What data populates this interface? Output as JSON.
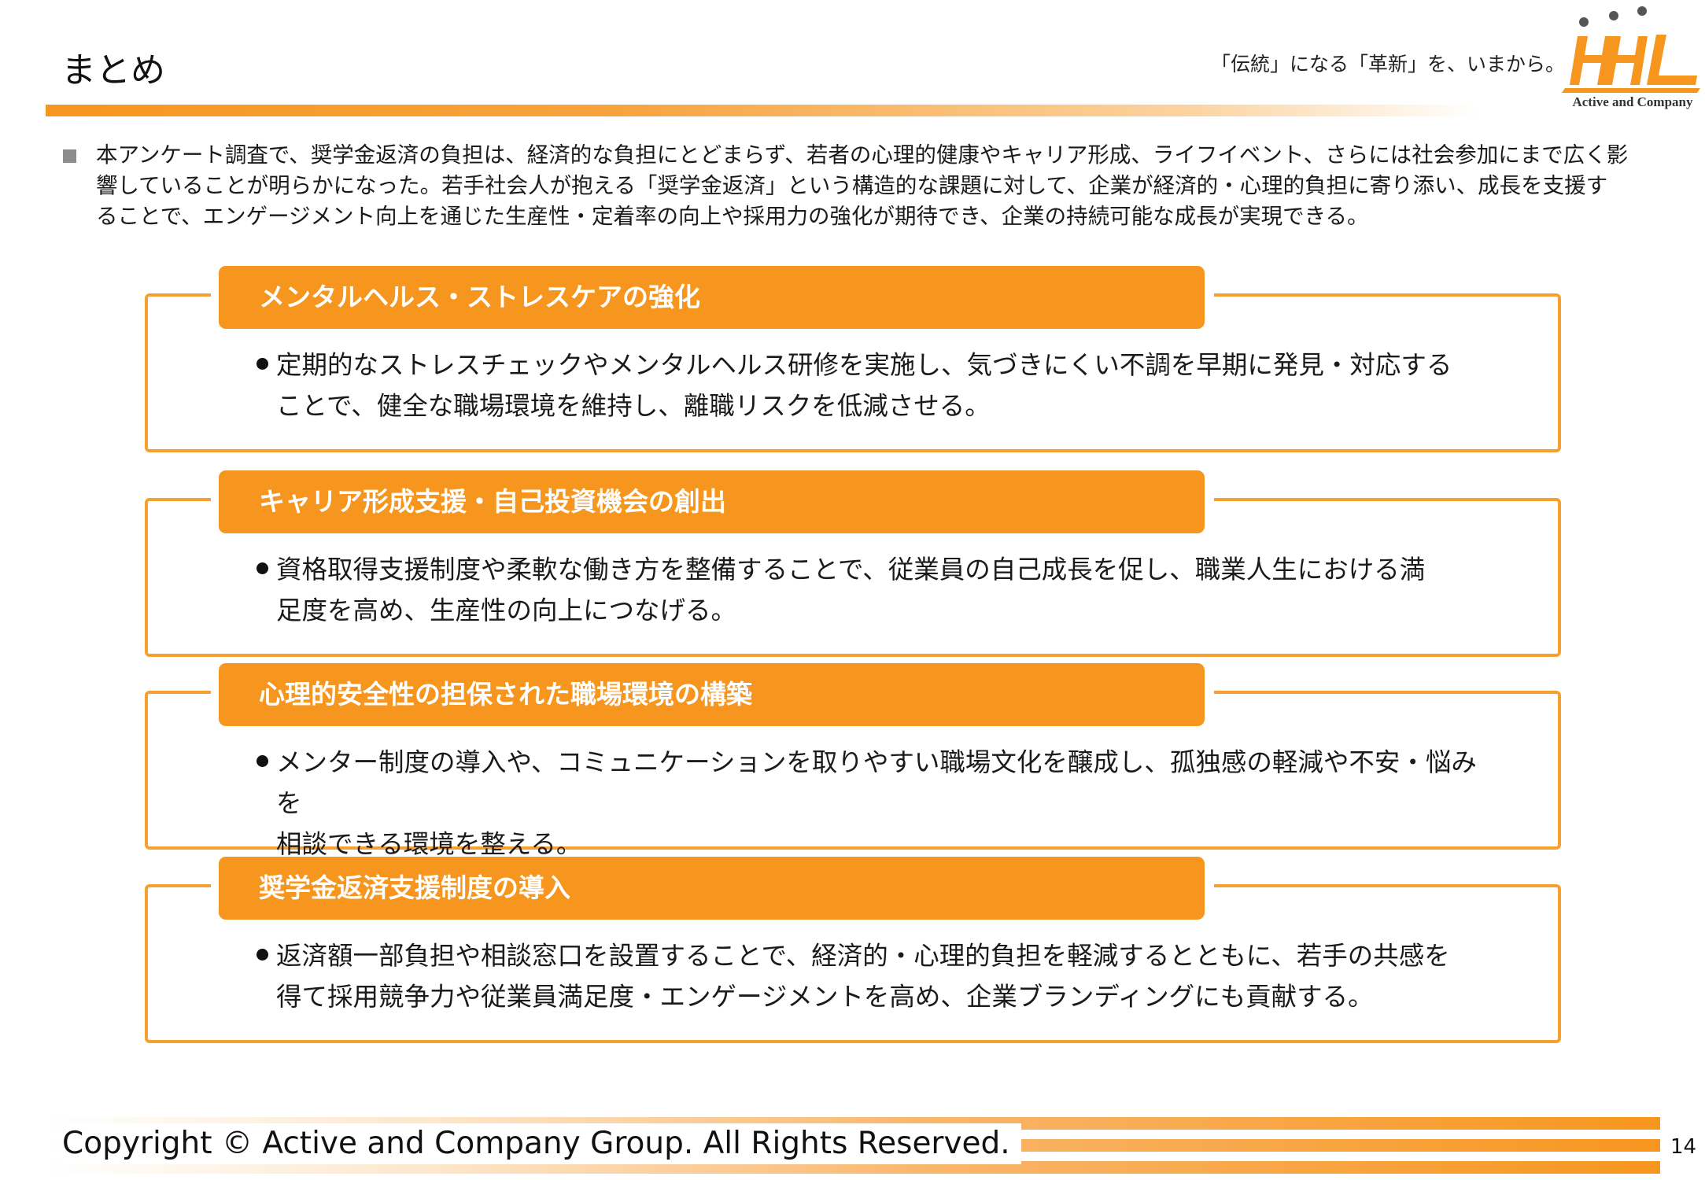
{
  "header": {
    "title": "まとめ",
    "tagline": "「伝統」になる「革新」を、いまから。",
    "logo_caption": "Active and Company"
  },
  "summary": {
    "text": "本アンケート調査で、奨学金返済の負担は、経済的な負担にとどまらず、若者の心理的健康やキャリア形成、ライフイベント、さらには社会参加にまで広く影響していることが明らかになった。若手社会人が抱える「奨学金返済」という構造的な課題に対して、企業が経済的・心理的負担に寄り添い、成長を支援することで、エンゲージメント向上を通じた生産性・定着率の向上や採用力の強化が期待でき、企業の持続可能な成長が実現できる。"
  },
  "sections": [
    {
      "heading": "メンタルヘルス・ストレスケアの強化",
      "lines": [
        "定期的なストレスチェックやメンタルヘルス研修を実施し、気づきにくい不調を早期に発見・対応する",
        "ことで、健全な職場環境を維持し、離職リスクを低減させる。"
      ]
    },
    {
      "heading": "キャリア形成支援・自己投資機会の創出",
      "lines": [
        "資格取得支援制度や柔軟な働き方を整備することで、従業員の自己成長を促し、職業人生における満",
        "足度を高め、生産性の向上につなげる。"
      ]
    },
    {
      "heading": "心理的安全性の担保された職場環境の構築",
      "lines": [
        "メンター制度の導入や、コミュニケーションを取りやすい職場文化を醸成し、孤独感の軽減や不安・悩みを",
        "相談できる環境を整える。"
      ]
    },
    {
      "heading": "奨学金返済支援制度の導入",
      "lines": [
        "返済額一部負担や相談窓口を設置することで、経済的・心理的負担を軽減するとともに、若手の共感を",
        "得て採用競争力や従業員満足度・エンゲージメントを高め、企業ブランディングにも貢献する。"
      ]
    }
  ],
  "footer": {
    "copyright": "Copyright © Active and Company Group. All Rights Reserved.",
    "page_number": "14"
  },
  "colors": {
    "accent": "#f7961e",
    "border": "#f7a030",
    "bullet_square": "#8c8c8c"
  }
}
